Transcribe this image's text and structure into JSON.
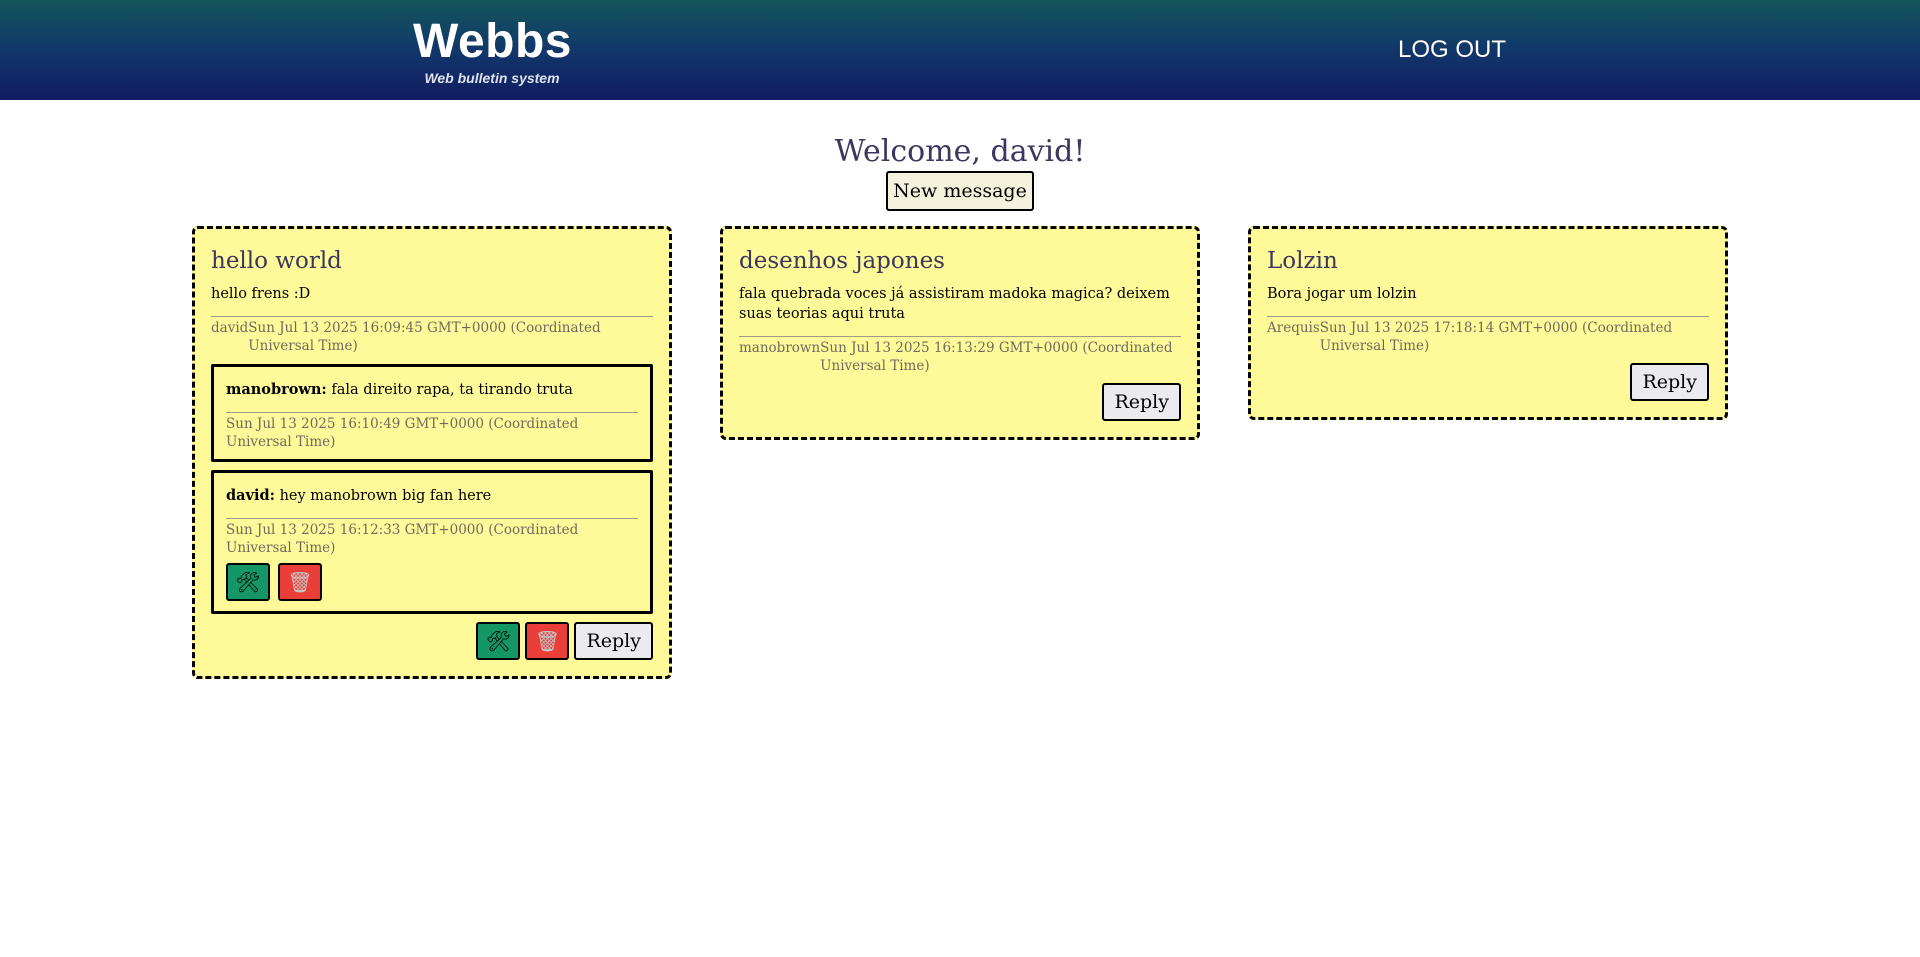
{
  "header": {
    "title": "Webbs",
    "subtitle": "Web bulletin system",
    "logout_label": "LOG OUT"
  },
  "welcome": "Welcome, david!",
  "new_message_label": "New message",
  "icons": {
    "edit": "wrench-hammer-icon",
    "delete": "trash-basket-icon"
  },
  "colors": {
    "header_top": "#13565a",
    "header_bottom": "#111c62",
    "card_bg": "#fffa99",
    "edit_button": "#159765",
    "delete_button": "#ea3e39",
    "title_text": "#3a385e"
  },
  "posts": [
    {
      "title": "hello world",
      "body": "hello frens :D",
      "author": "david",
      "date": "Sun Jul 13 2025 16:09:45 GMT+0000 (Coordinated Universal Time)",
      "reply_label": "Reply",
      "replies": [
        {
          "author": "manobrown:",
          "text": " fala direito rapa, ta tirando truta",
          "date": "Sun Jul 13 2025 16:10:49 GMT+0000 (Coordinated Universal Time)"
        },
        {
          "author": "david:",
          "text": " hey manobrown big fan here",
          "date": "Sun Jul 13 2025 16:12:33 GMT+0000 (Coordinated Universal Time)"
        }
      ]
    },
    {
      "title": "desenhos japones",
      "body": "fala quebrada voces já assistiram madoka magica? deixem suas teorias aqui truta",
      "author": "manobrown",
      "date": "Sun Jul 13 2025 16:13:29 GMT+0000 (Coordinated Universal Time)",
      "reply_label": "Reply"
    },
    {
      "title": "Lolzin",
      "body": "Bora jogar um lolzin",
      "author": "Arequis",
      "date": "Sun Jul 13 2025 17:18:14 GMT+0000 (Coordinated Universal Time)",
      "reply_label": "Reply"
    }
  ]
}
